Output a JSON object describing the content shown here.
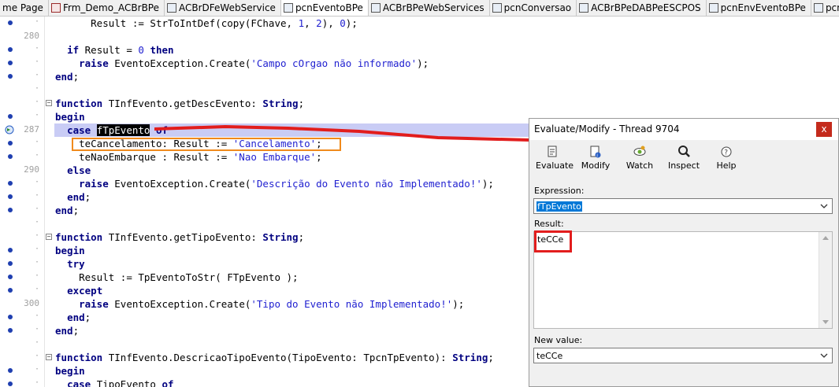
{
  "tabs": [
    {
      "label": "me Page",
      "icon": "none"
    },
    {
      "label": "Frm_Demo_ACBrBPe",
      "icon": "form"
    },
    {
      "label": "ACBrDFeWebService",
      "icon": "unit"
    },
    {
      "label": "pcnEventoBPe",
      "icon": "unit"
    },
    {
      "label": "ACBrBPeWebServices",
      "icon": "unit"
    },
    {
      "label": "pcnConversao",
      "icon": "unit"
    },
    {
      "label": "ACBrBPeDABPeESCPOS",
      "icon": "unit"
    },
    {
      "label": "pcnEnvEventoBPe",
      "icon": "unit"
    },
    {
      "label": "pcnRetDistDFeInt",
      "icon": "unit"
    }
  ],
  "active_tab": 3,
  "code_lines": [
    {
      "dot": true,
      "num": "",
      "fold": false,
      "indent": "      ",
      "tokens": [
        [
          "Result := StrToIntDef(copy(FChave, ",
          ""
        ],
        [
          "1",
          "num"
        ],
        [
          ", ",
          ""
        ],
        [
          "2",
          "num"
        ],
        [
          "), ",
          ""
        ],
        [
          "0",
          "num"
        ],
        [
          ");",
          ""
        ]
      ]
    },
    {
      "dot": false,
      "num": "280",
      "fold": false,
      "indent": "",
      "tokens": []
    },
    {
      "dot": true,
      "num": "",
      "fold": false,
      "indent": "  ",
      "tokens": [
        [
          "if",
          "kw"
        ],
        [
          " Result = ",
          ""
        ],
        [
          "0",
          "num"
        ],
        [
          " ",
          ""
        ],
        [
          "then",
          "kw"
        ]
      ]
    },
    {
      "dot": true,
      "num": "",
      "fold": false,
      "indent": "    ",
      "tokens": [
        [
          "raise",
          "kw"
        ],
        [
          " EventoException.Create(",
          ""
        ],
        [
          "'Campo cOrgao não informado'",
          "str"
        ],
        [
          ");",
          ""
        ]
      ]
    },
    {
      "dot": true,
      "num": "",
      "fold": false,
      "indent": "",
      "tokens": [
        [
          "end",
          "kw"
        ],
        [
          ";",
          ""
        ]
      ]
    },
    {
      "dot": false,
      "num": "",
      "fold": false,
      "indent": "",
      "tokens": []
    },
    {
      "dot": false,
      "num": "",
      "fold": true,
      "indent": "",
      "tokens": [
        [
          "function",
          "kw"
        ],
        [
          " TInfEvento.getDescEvento: ",
          ""
        ],
        [
          "String",
          "kw"
        ],
        [
          ";",
          ""
        ]
      ]
    },
    {
      "dot": true,
      "num": "",
      "fold": false,
      "indent": "",
      "tokens": [
        [
          "begin",
          "kw"
        ]
      ]
    },
    {
      "dot": false,
      "num": "287",
      "fold": false,
      "exec": true,
      "hl": true,
      "indent": "  ",
      "tokens": [
        [
          "case",
          "kw"
        ],
        [
          " ",
          ""
        ],
        [
          "fTpEvento",
          "sel"
        ],
        [
          " ",
          ""
        ],
        [
          "of",
          "kw"
        ]
      ]
    },
    {
      "dot": true,
      "num": "",
      "fold": false,
      "indent": "    ",
      "tokens": [
        [
          "teCancelamento: Result := ",
          ""
        ],
        [
          "'Cancelamento'",
          "str"
        ],
        [
          ";",
          ""
        ]
      ]
    },
    {
      "dot": true,
      "num": "",
      "fold": false,
      "indent": "    ",
      "tokens": [
        [
          "teNaoEmbarque : Result := ",
          ""
        ],
        [
          "'Nao Embarque'",
          "str"
        ],
        [
          ";",
          ""
        ]
      ]
    },
    {
      "dot": false,
      "num": "290",
      "fold": false,
      "indent": "  ",
      "tokens": [
        [
          "else",
          "kw"
        ]
      ]
    },
    {
      "dot": true,
      "num": "",
      "fold": false,
      "indent": "    ",
      "tokens": [
        [
          "raise",
          "kw"
        ],
        [
          " EventoException.Create(",
          ""
        ],
        [
          "'Descrição do Evento não Implementado!'",
          "str"
        ],
        [
          ");",
          ""
        ]
      ]
    },
    {
      "dot": true,
      "num": "",
      "fold": false,
      "indent": "  ",
      "tokens": [
        [
          "end",
          "kw"
        ],
        [
          ";",
          ""
        ]
      ]
    },
    {
      "dot": true,
      "num": "",
      "fold": false,
      "indent": "",
      "tokens": [
        [
          "end",
          "kw"
        ],
        [
          ";",
          ""
        ]
      ]
    },
    {
      "dot": false,
      "num": "",
      "fold": false,
      "indent": "",
      "tokens": []
    },
    {
      "dot": false,
      "num": "",
      "fold": true,
      "indent": "",
      "tokens": [
        [
          "function",
          "kw"
        ],
        [
          " TInfEvento.getTipoEvento: ",
          ""
        ],
        [
          "String",
          "kw"
        ],
        [
          ";",
          ""
        ]
      ]
    },
    {
      "dot": true,
      "num": "",
      "fold": false,
      "indent": "",
      "tokens": [
        [
          "begin",
          "kw"
        ]
      ]
    },
    {
      "dot": true,
      "num": "",
      "fold": false,
      "indent": "  ",
      "tokens": [
        [
          "try",
          "kw"
        ]
      ]
    },
    {
      "dot": true,
      "num": "",
      "fold": false,
      "indent": "    ",
      "tokens": [
        [
          "Result := TpEventoToStr( FTpEvento );",
          ""
        ]
      ]
    },
    {
      "dot": true,
      "num": "",
      "fold": false,
      "indent": "  ",
      "tokens": [
        [
          "except",
          "kw"
        ]
      ]
    },
    {
      "dot": false,
      "num": "300",
      "fold": false,
      "indent": "    ",
      "tokens": [
        [
          "raise",
          "kw"
        ],
        [
          " EventoException.Create(",
          ""
        ],
        [
          "'Tipo do Evento não Implementado!'",
          "str"
        ],
        [
          ");",
          ""
        ]
      ]
    },
    {
      "dot": true,
      "num": "",
      "fold": false,
      "indent": "  ",
      "tokens": [
        [
          "end",
          "kw"
        ],
        [
          ";",
          ""
        ]
      ]
    },
    {
      "dot": true,
      "num": "",
      "fold": false,
      "indent": "",
      "tokens": [
        [
          "end",
          "kw"
        ],
        [
          ";",
          ""
        ]
      ]
    },
    {
      "dot": false,
      "num": "",
      "fold": false,
      "indent": "",
      "tokens": []
    },
    {
      "dot": false,
      "num": "",
      "fold": true,
      "indent": "",
      "tokens": [
        [
          "function",
          "kw"
        ],
        [
          " TInfEvento.DescricaoTipoEvento(TipoEvento: TpcnTpEvento): ",
          ""
        ],
        [
          "String",
          "kw"
        ],
        [
          ";",
          ""
        ]
      ]
    },
    {
      "dot": true,
      "num": "",
      "fold": false,
      "indent": "",
      "tokens": [
        [
          "begin",
          "kw"
        ]
      ]
    },
    {
      "dot": true,
      "num": "",
      "fold": false,
      "indent": "  ",
      "tokens": [
        [
          "case",
          "kw"
        ],
        [
          " TipoEvento ",
          ""
        ],
        [
          "of",
          "kw"
        ]
      ]
    }
  ],
  "dialog": {
    "title": "Evaluate/Modify - Thread 9704",
    "close": "x",
    "buttons": [
      {
        "label": "Evaluate",
        "icon": "evaluate-icon"
      },
      {
        "label": "Modify",
        "icon": "modify-icon"
      },
      {
        "label": "Watch",
        "icon": "watch-icon"
      },
      {
        "label": "Inspect",
        "icon": "inspect-icon"
      },
      {
        "label": "Help",
        "icon": "help-icon"
      }
    ],
    "expression_label": "Expression:",
    "expression_value": "fTpEvento",
    "result_label": "Result:",
    "result_value": "teCCe",
    "new_value_label": "New value:",
    "new_value": "teCCe"
  },
  "colors": {
    "keyword": "#000080",
    "string": "#1f1fd0",
    "highlight_line": "#c9ccf5",
    "annotation_red": "#e21d1d",
    "annotation_orange": "#f08a1c"
  }
}
